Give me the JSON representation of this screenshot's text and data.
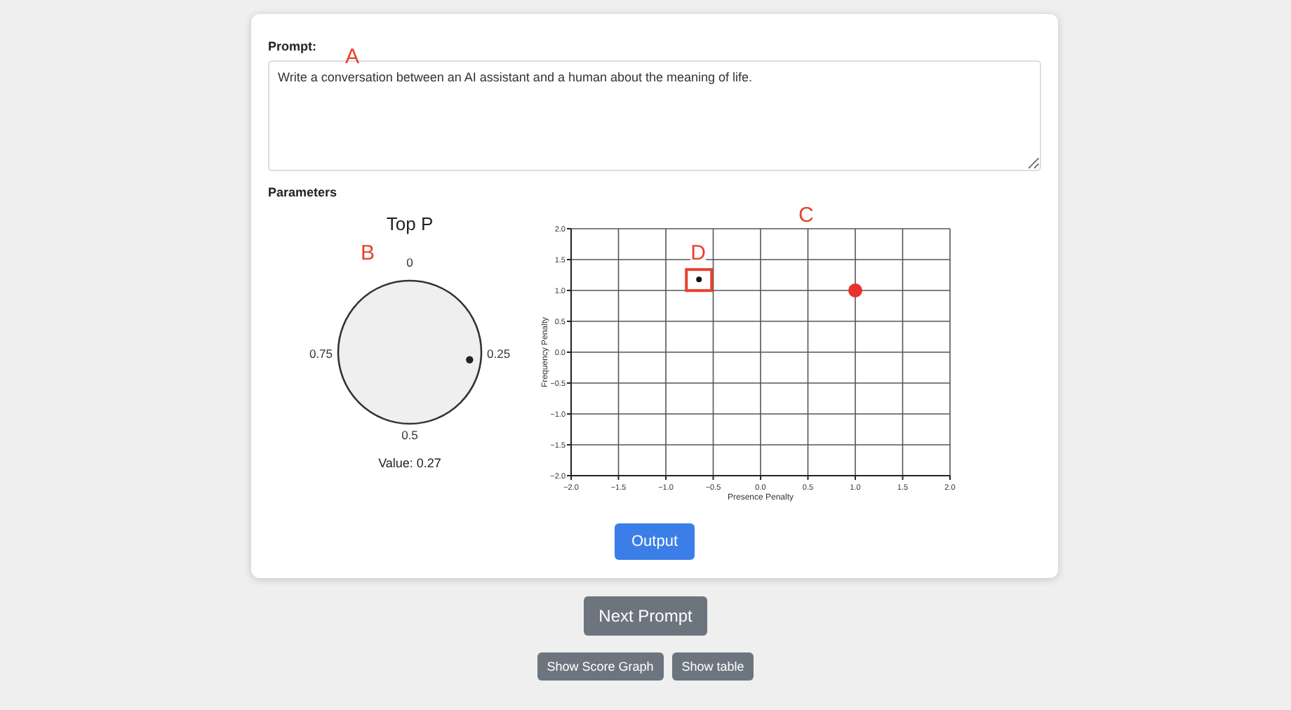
{
  "prompt": {
    "label": "Prompt:",
    "annotation": "A",
    "value": "Write a conversation between an AI assistant and a human about the meaning of life."
  },
  "parameters": {
    "title": "Parameters",
    "knob": {
      "title": "Top P",
      "annotation": "B",
      "labels": [
        "0",
        "0.25",
        "0.5",
        "0.75"
      ],
      "reading": "Value: 0.27"
    },
    "chart": {
      "annotation": "C",
      "marker_annotation": "D",
      "chart_data": {
        "type": "scatter",
        "grid": true,
        "xlabel": "Presence Penalty",
        "ylabel": "Frequency Penalty",
        "xlim": [
          -2,
          2
        ],
        "ylim": [
          -2,
          2
        ],
        "xticks": [
          {
            "value": -2,
            "label": "−2.0"
          },
          {
            "value": -1.5,
            "label": "−1.5"
          },
          {
            "value": -1,
            "label": "−1.0"
          },
          {
            "value": -0.5,
            "label": "−0.5"
          },
          {
            "value": 0,
            "label": "0.0"
          },
          {
            "value": 0.5,
            "label": "0.5"
          },
          {
            "value": 1,
            "label": "1.0"
          },
          {
            "value": 1.5,
            "label": "1.5"
          },
          {
            "value": 2,
            "label": "2.0"
          }
        ],
        "yticks": [
          {
            "value": -2,
            "label": "−2.0"
          },
          {
            "value": -1.5,
            "label": "−1.5"
          },
          {
            "value": -1,
            "label": "−1.0"
          },
          {
            "value": -0.5,
            "label": "−0.5"
          },
          {
            "value": 0,
            "label": "0.0"
          },
          {
            "value": 0.5,
            "label": "0.5"
          },
          {
            "value": 1,
            "label": "1.0"
          },
          {
            "value": 1.5,
            "label": "1.5"
          },
          {
            "value": 2,
            "label": "2.0"
          }
        ],
        "series": [
          {
            "color": "#111111",
            "x": [
              -0.65
            ],
            "values": [
              1.18
            ]
          },
          {
            "color": "#e8322a",
            "x": [
              1.0
            ],
            "values": [
              1.0
            ]
          }
        ]
      }
    }
  },
  "output_button": "Output",
  "next_button": "Next Prompt",
  "bottom_buttons": [
    "Show Score Graph",
    "Show table"
  ]
}
